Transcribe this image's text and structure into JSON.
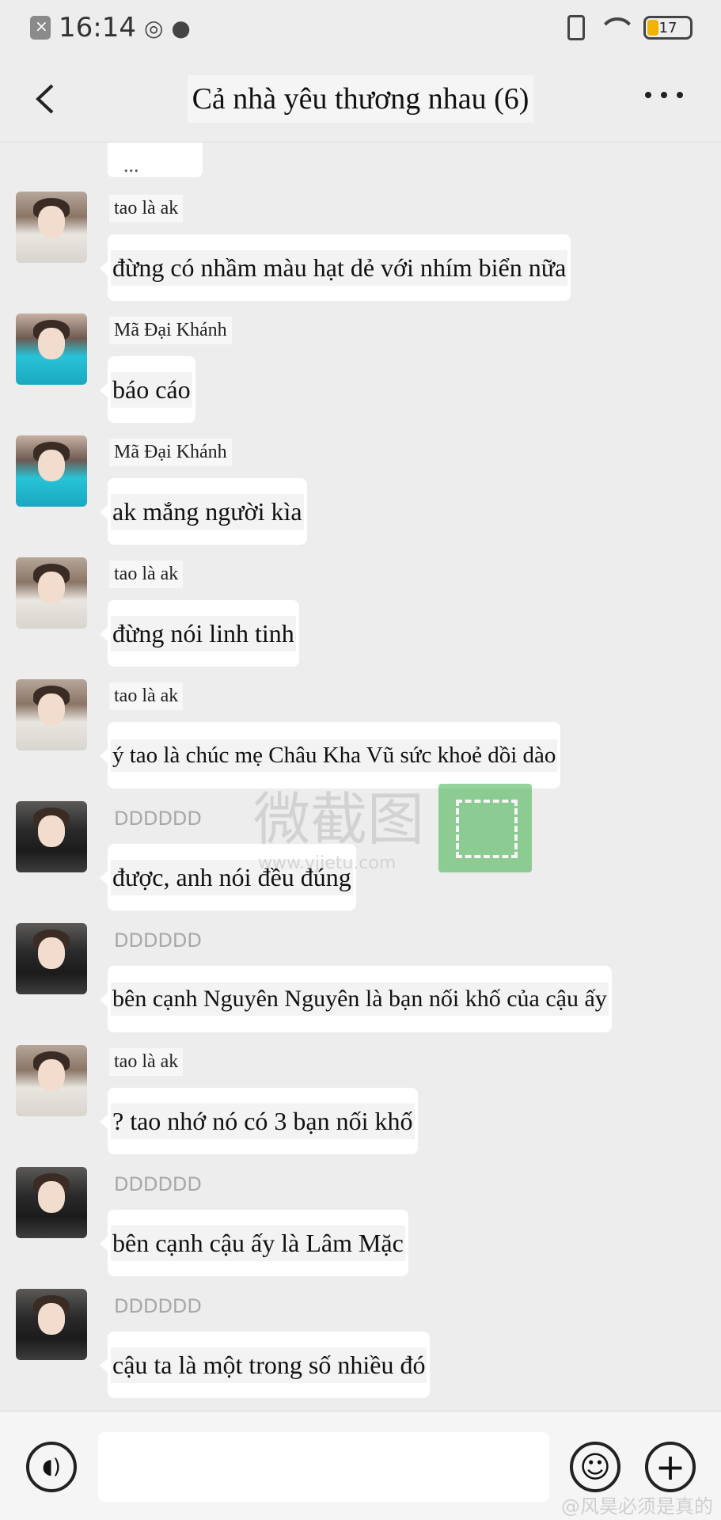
{
  "status": {
    "time": "16:14",
    "battery": "17"
  },
  "header": {
    "title": "Cả nhà yêu thương nhau (6)"
  },
  "chat": {
    "partial_text": "...",
    "messages": [
      {
        "sender": "tao là ak",
        "text": "đừng có nhầm màu hạt dẻ với nhím biển nữa",
        "avatar": "ak"
      },
      {
        "sender": "Mã Đại Khánh",
        "text": "báo cáo",
        "avatar": "mdk"
      },
      {
        "sender": "Mã Đại Khánh",
        "text": "ak mắng người kìa",
        "avatar": "mdk"
      },
      {
        "sender": "tao là ak",
        "text": "đừng nói linh tinh",
        "avatar": "ak"
      },
      {
        "sender": "tao là ak",
        "text": "ý tao là chúc mẹ Châu Kha Vũ sức khoẻ dồi dào",
        "avatar": "ak"
      },
      {
        "sender": "DDDDDD",
        "text": "được, anh nói đều đúng",
        "avatar": "ddd"
      },
      {
        "sender": "DDDDDD",
        "text": "bên cạnh Nguyên Nguyên là bạn nối khố của cậu ấy",
        "avatar": "ddd"
      },
      {
        "sender": "tao là ak",
        "text": "? tao nhớ nó có 3 bạn nối khố",
        "avatar": "ak"
      },
      {
        "sender": "DDDDDD",
        "text": "bên cạnh cậu ấy là Lâm Mặc",
        "avatar": "ddd"
      },
      {
        "sender": "DDDDDD",
        "text": "cậu ta là một trong số nhiều đó",
        "avatar": "ddd"
      }
    ]
  },
  "watermark": {
    "text": "微截图",
    "url": "www.vjietu.com"
  },
  "input_bar": {
    "placeholder": "",
    "voice_icon": "voice-icon",
    "emoji_icon": "emoji-icon",
    "plus_icon": "plus-icon"
  },
  "footer": {
    "weibo_mark": "@风昊必须是真的"
  }
}
